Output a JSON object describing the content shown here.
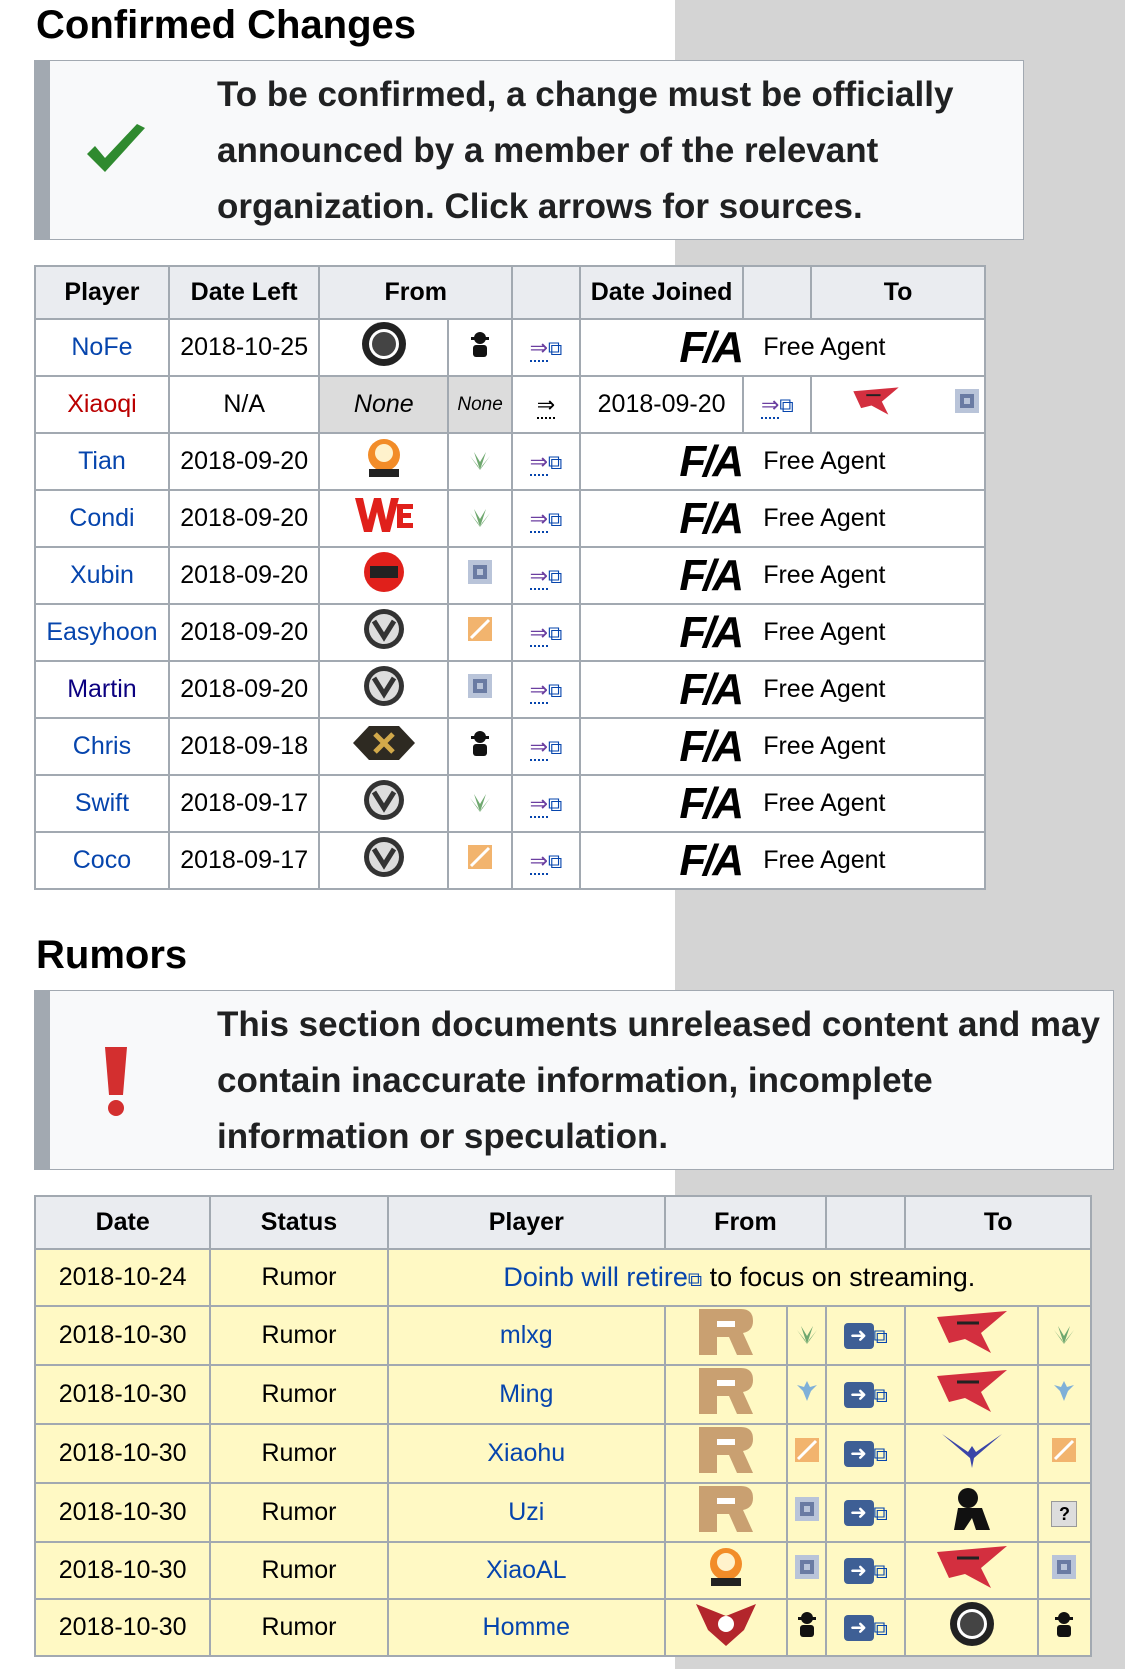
{
  "confirmed": {
    "title": "Confirmed Changes",
    "notice": "To be confirmed, a change must be officially announced by a member of the relevant organization. Click arrows for sources.",
    "headers": {
      "player": "Player",
      "date_left": "Date Left",
      "from": "From",
      "date_joined": "Date Joined",
      "to": "To"
    },
    "rows": [
      {
        "player": "NoFe",
        "date_left": "2018-10-25",
        "from_team": "edg-logo",
        "from_role": "coach-icon",
        "to": "Free Agent"
      },
      {
        "player": "Xiaoqi",
        "date_left": "N/A",
        "from_team": "None",
        "from_role": "None",
        "arrow": "⇒",
        "date_joined": "2018-09-20",
        "to_team": "rogue-warriors-logo",
        "to_role": "support-icon"
      },
      {
        "player": "Tian",
        "date_left": "2018-09-20",
        "from_team": "sn-gaming-logo",
        "from_role": "jungle-icon",
        "to": "Free Agent"
      },
      {
        "player": "Condi",
        "date_left": "2018-09-20",
        "from_team": "we-logo",
        "from_role": "jungle-icon",
        "to": "Free Agent"
      },
      {
        "player": "Xubin",
        "date_left": "2018-09-20",
        "from_team": "top-esports-logo",
        "from_role": "support-icon",
        "to": "Free Agent"
      },
      {
        "player": "Easyhoon",
        "date_left": "2018-09-20",
        "from_team": "vici-gaming-logo",
        "from_role": "mid-icon",
        "to": "Free Agent"
      },
      {
        "player": "Martin",
        "date_left": "2018-09-20",
        "from_team": "vici-gaming-logo",
        "from_role": "support-icon",
        "to": "Free Agent"
      },
      {
        "player": "Chris",
        "date_left": "2018-09-18",
        "from_team": "jdg-logo",
        "from_role": "coach-icon",
        "to": "Free Agent"
      },
      {
        "player": "Swift",
        "date_left": "2018-09-17",
        "from_team": "vici-gaming-logo",
        "from_role": "jungle-icon",
        "to": "Free Agent"
      },
      {
        "player": "Coco",
        "date_left": "2018-09-17",
        "from_team": "vici-gaming-logo",
        "from_role": "mid-icon",
        "to": "Free Agent"
      }
    ],
    "fa_logo": "F/A"
  },
  "rumors": {
    "title": "Rumors",
    "notice": "This section documents unreleased content and may contain inaccurate information, incomplete information or speculation.",
    "headers": {
      "date": "Date",
      "status": "Status",
      "player": "Player",
      "from": "From",
      "to": "To"
    },
    "doinb_row": {
      "date": "2018-10-24",
      "status": "Rumor",
      "link": "Doinb will retire",
      "rest": " to focus on streaming."
    },
    "rows": [
      {
        "date": "2018-10-30",
        "status": "Rumor",
        "player": "mlxg",
        "from_team": "rng-logo",
        "from_role": "jungle-icon",
        "to_team": "rogue-warriors-logo",
        "to_role": "jungle-icon"
      },
      {
        "date": "2018-10-30",
        "status": "Rumor",
        "player": "Ming",
        "from_team": "rng-logo",
        "from_role": "top-icon",
        "to_team": "rogue-warriors-logo",
        "to_role": "top-icon"
      },
      {
        "date": "2018-10-30",
        "status": "Rumor",
        "player": "Xiaohu",
        "from_team": "rng-logo",
        "from_role": "mid-icon",
        "to_team": "flash-wolves-logo",
        "to_role": "mid-icon"
      },
      {
        "date": "2018-10-30",
        "status": "Rumor",
        "player": "Uzi",
        "from_team": "rng-logo",
        "from_role": "support-icon",
        "to_team": "retired-icon",
        "to_role": "?"
      },
      {
        "date": "2018-10-30",
        "status": "Rumor",
        "player": "XiaoAL",
        "from_team": "sn-gaming-logo",
        "from_role": "support-icon",
        "to_team": "rogue-warriors-logo",
        "to_role": "support-icon"
      },
      {
        "date": "2018-10-30",
        "status": "Rumor",
        "player": "Homme",
        "from_team": "royal-never-give-up-coach-logo",
        "from_role": "coach-icon",
        "to_team": "edg-logo",
        "to_role": "coach-icon"
      }
    ]
  }
}
